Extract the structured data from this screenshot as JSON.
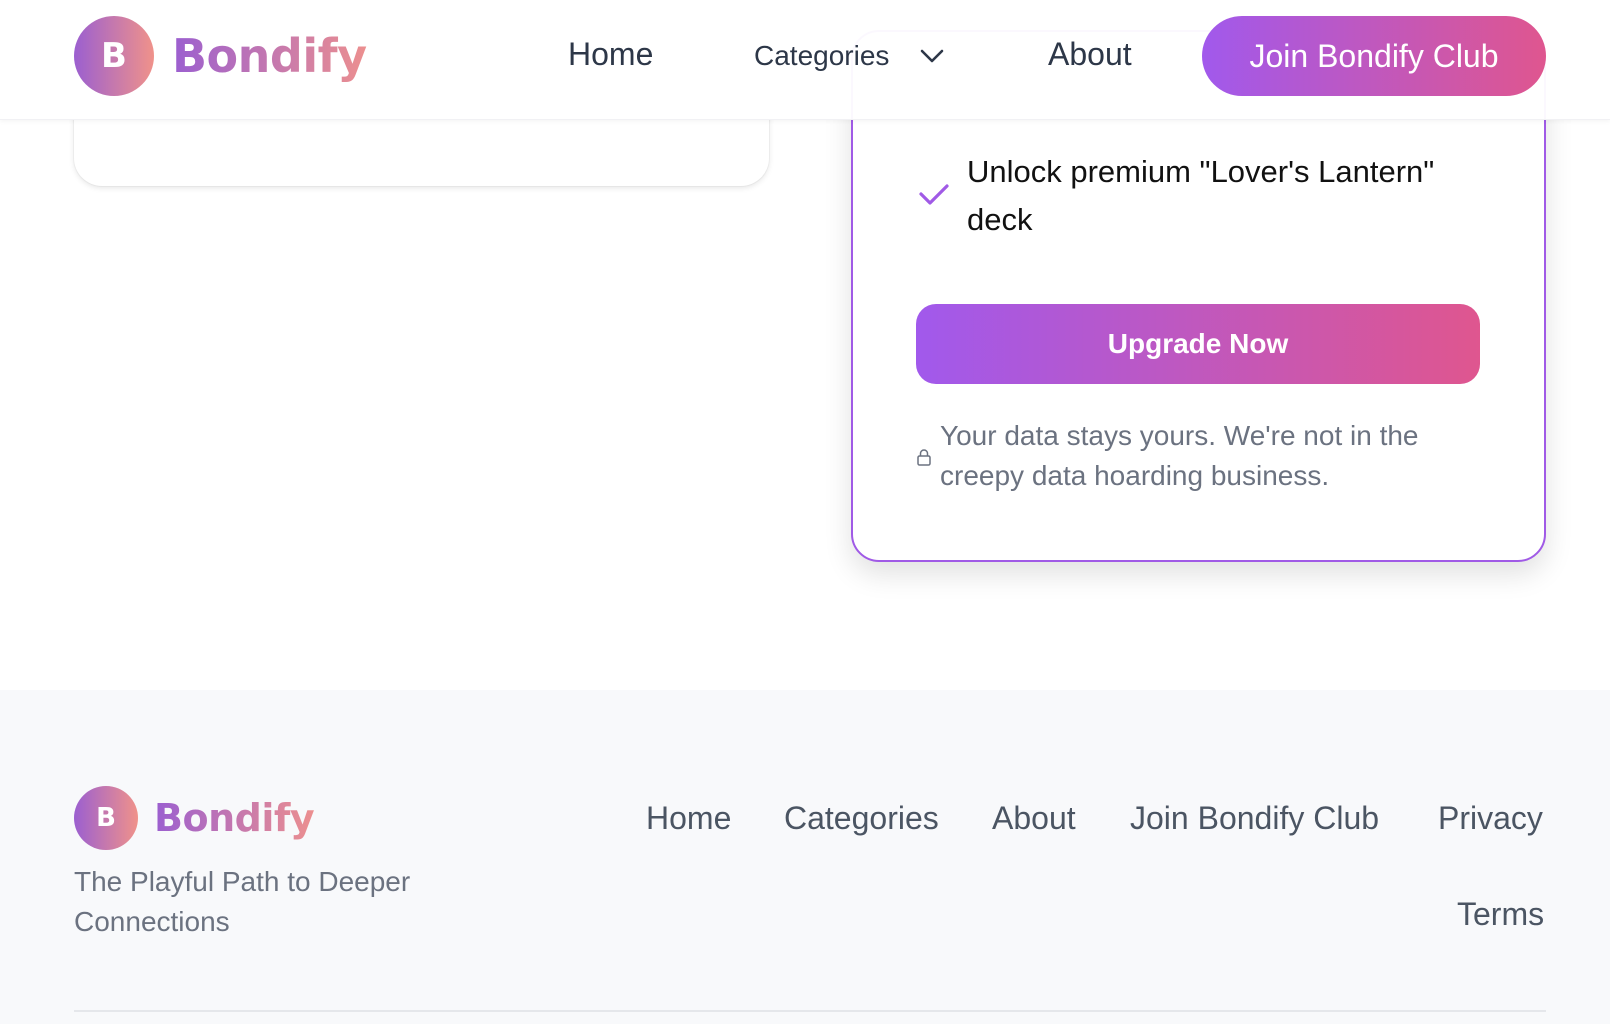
{
  "brand": {
    "initial": "B",
    "name": "Bondify",
    "gradient_start": "#9b5fd0",
    "gradient_end": "#f0928a"
  },
  "header": {
    "nav": {
      "home": "Home",
      "categories": "Categories",
      "about": "About"
    },
    "join_button": "Join Bondify Club"
  },
  "plan_card": {
    "features": [
      "Unlock premium \"Lover's Lantern\" deck"
    ],
    "upgrade_button": "Upgrade Now",
    "privacy_note": "Your data stays yours. We're not in the creepy data hoarding business.",
    "accent_color": "#a05ae6"
  },
  "footer": {
    "brand_name": "Bondify",
    "tagline": "The Playful Path to Deeper Connections",
    "links": {
      "home": "Home",
      "categories": "Categories",
      "about": "About",
      "join": "Join Bondify Club",
      "privacy": "Privacy",
      "terms": "Terms"
    }
  },
  "icons": {
    "check": "check-icon",
    "lock": "lock-icon",
    "chevron": "chevron-down-icon"
  }
}
